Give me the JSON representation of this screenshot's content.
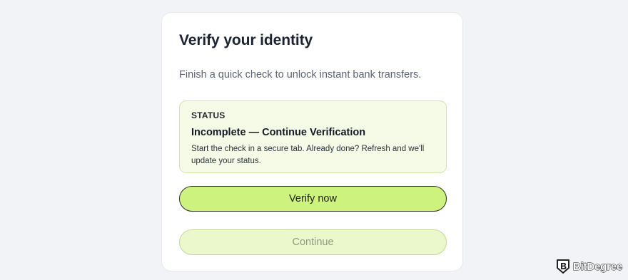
{
  "card": {
    "title": "Verify your identity",
    "subtitle": "Finish a quick check to unlock instant bank transfers."
  },
  "status": {
    "label": "STATUS",
    "title": "Incomplete — Continue Verification",
    "description": "Start the check in a secure tab. Already done? Refresh and we'll update your status."
  },
  "actions": {
    "verify_label": "Verify now",
    "continue_label": "Continue",
    "continue_disabled": true
  },
  "watermark": {
    "text": "BitDegree",
    "icon": "bitdegree-shield-logo"
  },
  "colors": {
    "accent": "#cdf27e",
    "accent_disabled": "#ebf8cb",
    "status_bg": "#f6fbe8",
    "page_bg": "#f1f3f6"
  }
}
